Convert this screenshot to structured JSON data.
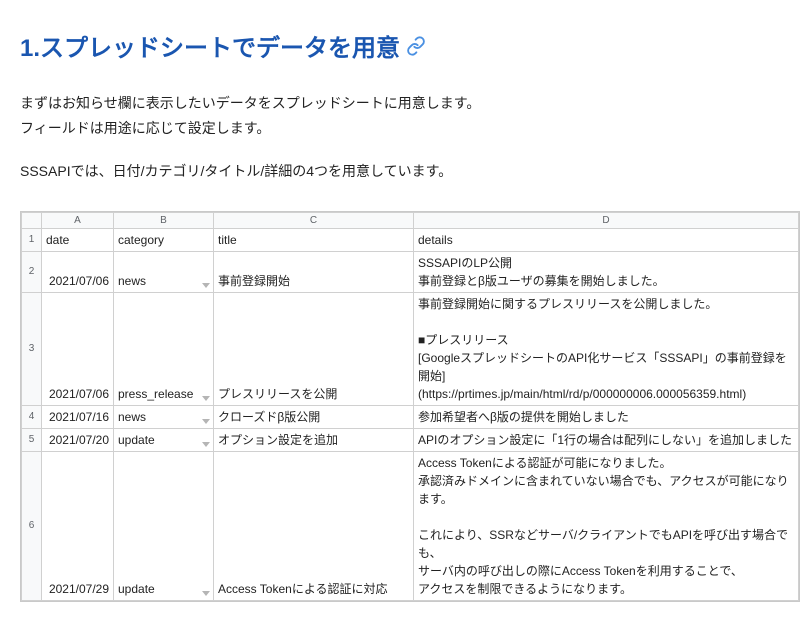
{
  "title": "1.スプレッドシートでデータを用意",
  "paragraphs": [
    [
      "まずはお知らせ欄に表示したいデータをスプレッドシートに用意します。",
      "フィールドは用途に応じて設定します。"
    ],
    [
      "SSSAPIでは、日付/カテゴリ/タイトル/詳細の4つを用意しています。"
    ]
  ],
  "columns": [
    "A",
    "B",
    "C",
    "D"
  ],
  "row_numbers": [
    "1",
    "2",
    "3",
    "4",
    "5",
    "6"
  ],
  "header_row": {
    "date": "date",
    "category": "category",
    "title": "title",
    "details": "details"
  },
  "rows": [
    {
      "date": "2021/07/06",
      "category": "news",
      "title": "事前登録開始",
      "details": "SSSAPIのLP公開\n事前登録とβ版ユーザの募集を開始しました。"
    },
    {
      "date": "2021/07/06",
      "category": "press_release",
      "title": "プレスリリースを公開",
      "details": "事前登録開始に関するプレスリリースを公開しました。\n\n■プレスリリース\n[GoogleスプレッドシートのAPI化サービス「SSSAPI」の事前登録を開始]\n(https://prtimes.jp/main/html/rd/p/000000006.000056359.html)"
    },
    {
      "date": "2021/07/16",
      "category": "news",
      "title": "クローズドβ版公開",
      "details": "参加希望者へβ版の提供を開始しました"
    },
    {
      "date": "2021/07/20",
      "category": "update",
      "title": "オプション設定を追加",
      "details": "APIのオプション設定に「1行の場合は配列にしない」を追加しました"
    },
    {
      "date": "2021/07/29",
      "category": "update",
      "title": "Access Tokenによる認証に対応",
      "details": "Access Tokenによる認証が可能になりました。\n承認済みドメインに含まれていない場合でも、アクセスが可能になります。\n\nこれにより、SSRなどサーバ/クライアントでもAPIを呼び出す場合でも、\nサーバ内の呼び出しの際にAccess Tokenを利用することで、\nアクセスを制限できるようになります。"
    }
  ]
}
